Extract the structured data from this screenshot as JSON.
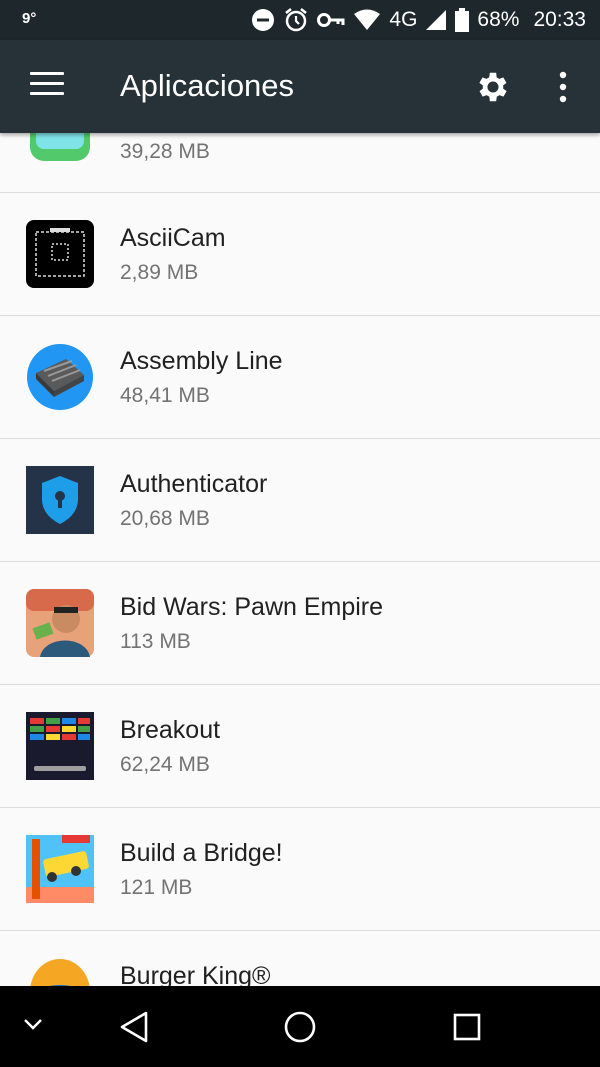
{
  "status_bar": {
    "temperature": "9°",
    "network": "4G",
    "battery": "68%",
    "time": "20:33",
    "icons": [
      "do-not-disturb-icon",
      "alarm-icon",
      "vpn-key-icon",
      "wifi-icon",
      "signal-icon",
      "battery-icon"
    ]
  },
  "app_bar": {
    "title": "Aplicaciones",
    "icons": [
      "menu-icon",
      "gear-icon",
      "more-vert-icon"
    ]
  },
  "apps": [
    {
      "name": "",
      "size": "39,28 MB",
      "icon": "green-app-icon"
    },
    {
      "name": "AsciiCam",
      "size": "2,89 MB",
      "icon": "asciicam-icon"
    },
    {
      "name": "Assembly Line",
      "size": "48,41 MB",
      "icon": "assembly-line-icon"
    },
    {
      "name": "Authenticator",
      "size": "20,68 MB",
      "icon": "authenticator-shield-icon"
    },
    {
      "name": "Bid Wars: Pawn Empire",
      "size": "113 MB",
      "icon": "bid-wars-icon"
    },
    {
      "name": "Breakout",
      "size": "62,24 MB",
      "icon": "breakout-icon"
    },
    {
      "name": "Build a Bridge!",
      "size": "121 MB",
      "icon": "build-a-bridge-icon"
    },
    {
      "name": "Burger King®",
      "size": "",
      "icon": "burger-king-icon"
    }
  ],
  "nav_bar": {
    "icons": [
      "hide-keyboard-chevron-icon",
      "back-icon",
      "home-icon",
      "recents-icon"
    ]
  },
  "colors": {
    "app_bar": "#263238",
    "status_bar": "#1e272c",
    "background": "#fafafa",
    "primary_text": "#212121",
    "secondary_text": "#737373"
  }
}
